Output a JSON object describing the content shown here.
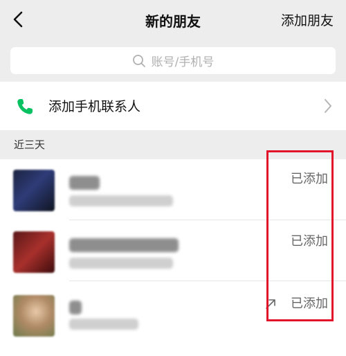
{
  "header": {
    "back_icon": "chevron-left-icon",
    "title": "新的朋友",
    "add_friend_label": "添加朋友"
  },
  "search": {
    "placeholder": "账号/手机号",
    "icon": "search-icon"
  },
  "phone_contacts": {
    "label": "添加手机联系人",
    "icon": "phone-icon",
    "icon_color": "#07c160"
  },
  "section_label": "近三天",
  "requests": [
    {
      "status": "已添加"
    },
    {
      "status": "已添加"
    },
    {
      "status": "已添加",
      "arrow_icon": "arrow-up-right-icon"
    }
  ],
  "colors": {
    "highlight_border": "#e3122b",
    "background": "#ededed"
  }
}
